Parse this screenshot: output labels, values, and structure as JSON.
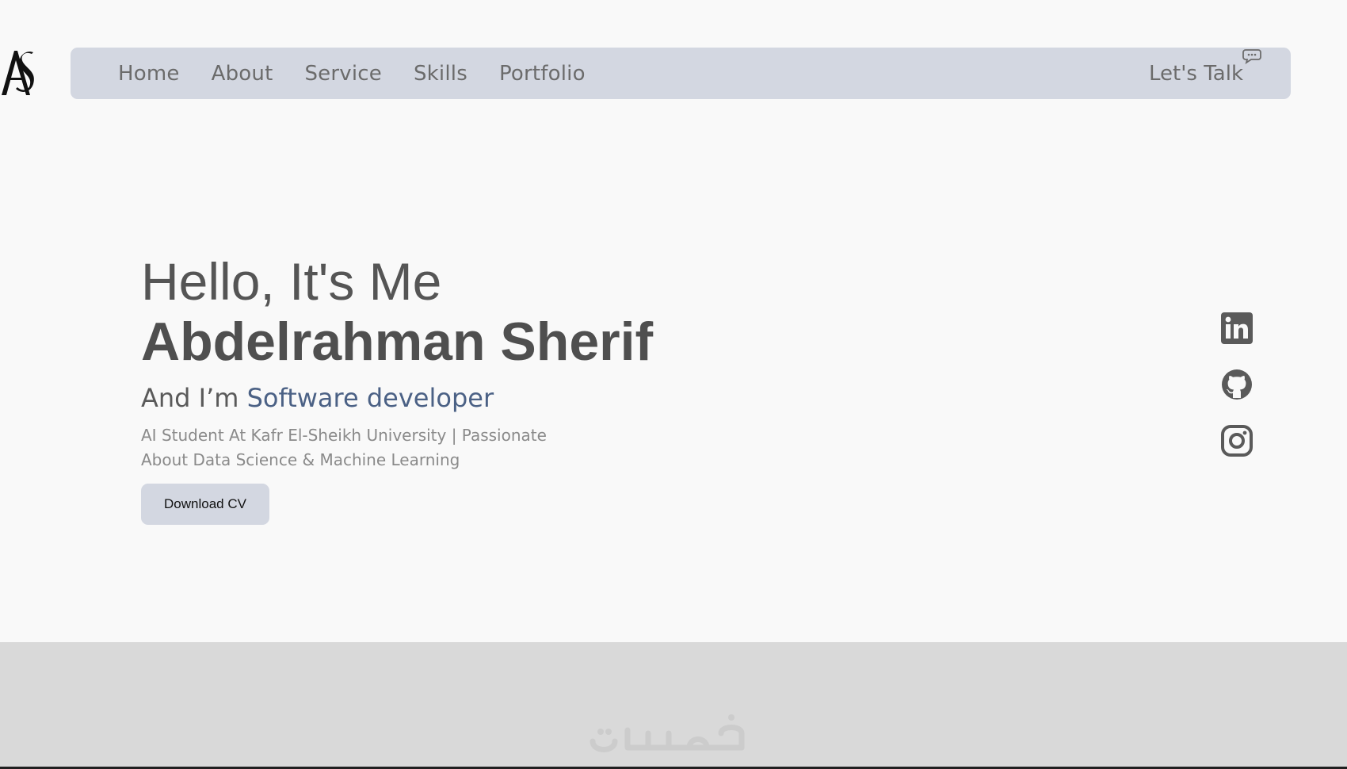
{
  "logo": {
    "icon": "as-monogram-logo"
  },
  "nav": {
    "links": [
      "Home",
      "About",
      "Service",
      "Skills",
      "Portfolio"
    ],
    "cta": "Let's Talk",
    "cta_icon": "chat-bubble-icon"
  },
  "hero": {
    "greeting": "Hello, It's Me",
    "name": "Abdelrahman Sherif",
    "role_prefix": "And I’m ",
    "role": "Software developer",
    "description": "AI Student At Kafr El-Sheikh University | Passionate About Data Science & Machine Learning",
    "download_label": "Download CV"
  },
  "socials": [
    {
      "icon": "linkedin-icon"
    },
    {
      "icon": "github-icon"
    },
    {
      "icon": "instagram-icon"
    }
  ],
  "watermark": {
    "text": "خمسات"
  },
  "colors": {
    "page_bg": "#f9f9f9",
    "nav_bg": "#d3d7e1",
    "accent": "#4b6185",
    "footer_bg": "#d9d9d9"
  }
}
